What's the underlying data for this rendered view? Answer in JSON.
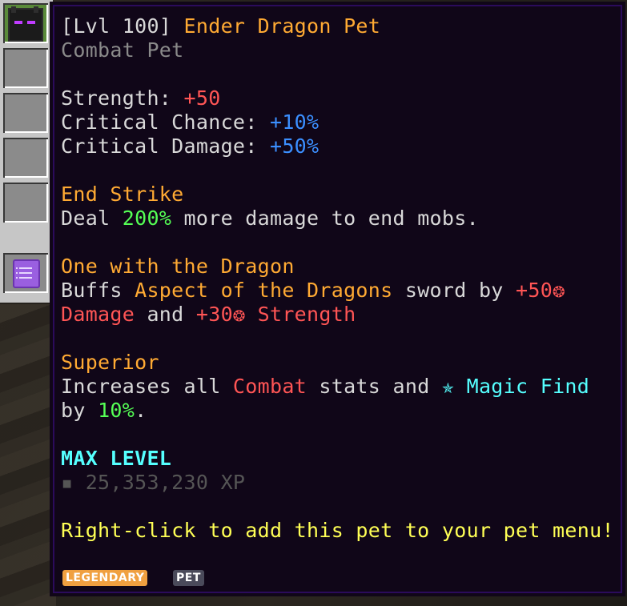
{
  "inventory": {
    "slots": [
      "pet-slot",
      "empty",
      "empty",
      "empty",
      "empty",
      "book-slot"
    ]
  },
  "tooltip": {
    "title_level": "[Lvl 100] ",
    "title_name": "Ender Dragon Pet",
    "subtitle": "Combat Pet",
    "stats": [
      {
        "label": "Strength: ",
        "value": "+50"
      },
      {
        "label": "Critical Chance: ",
        "value": "+10%"
      },
      {
        "label": "Critical Damage: ",
        "value": "+50%"
      }
    ],
    "ability1": {
      "name": "End Strike",
      "t1": "Deal ",
      "v1": "200%",
      "t2": " more damage to end mobs."
    },
    "ability2": {
      "name": "One with the Dragon",
      "t1": "Buffs ",
      "item": "Aspect of the Dragons",
      "t2": " sword by ",
      "v1": "+50❂",
      "v1b": "Damage",
      "t3": " and ",
      "v2": "+30❂ Strength"
    },
    "ability3": {
      "name": "Superior",
      "t1": "Increases all ",
      "v1": "Combat",
      "t2": " stats and ",
      "v2": "✯ Magic Find",
      "t3": "by ",
      "v3": "10%",
      "t4": "."
    },
    "max_level": "MAX LEVEL",
    "xp_bullet": "▪ ",
    "xp": "25,353,230 XP",
    "hint": "Right-click to add this pet to your pet menu!",
    "rarity_tag": "LEGENDARY",
    "type_tag": "PET"
  },
  "colors": {
    "gold": "#ffaa33",
    "red": "#ff5555",
    "blue": "#3b8fff",
    "green": "#55ff55",
    "aqua": "#55ffff",
    "yellow": "#ffff55",
    "legendary_tag": "#f0a040",
    "pet_tag": "#4a4a5a"
  }
}
